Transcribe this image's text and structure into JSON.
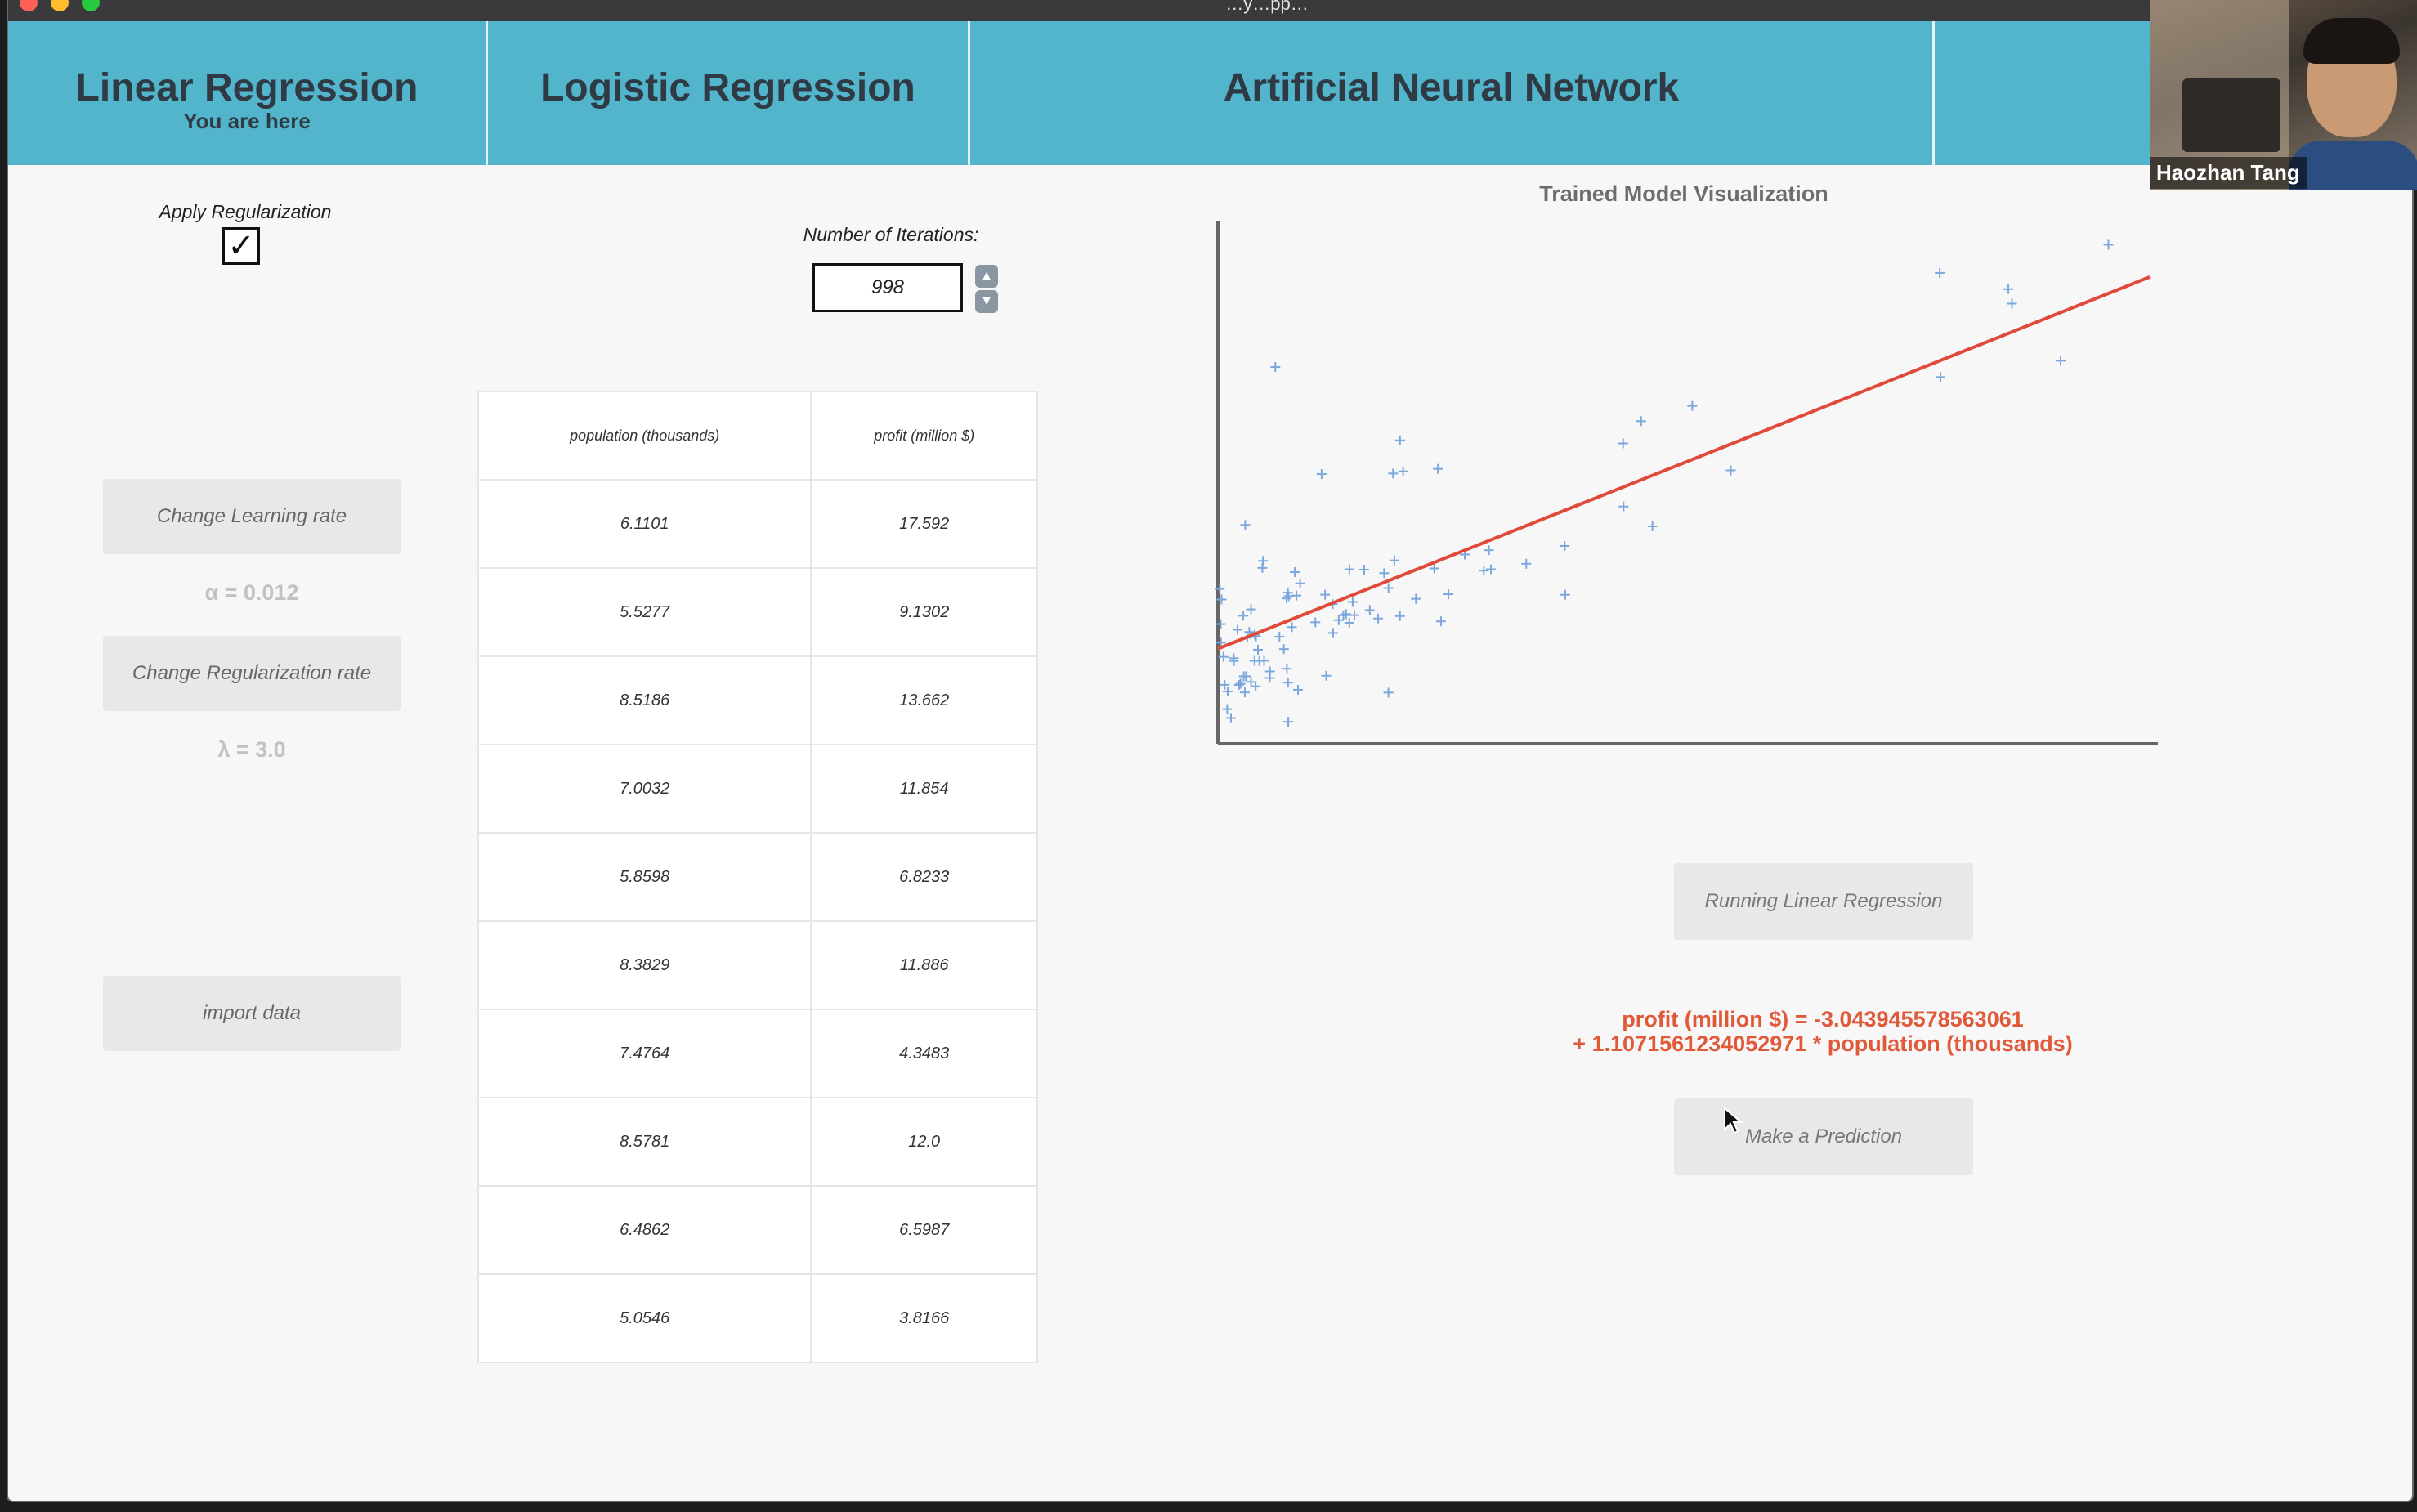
{
  "window": {
    "title": "…y…pp…"
  },
  "nav": {
    "tabs": [
      {
        "label": "Linear Regression",
        "sub": "You are here"
      },
      {
        "label": "Logistic Regression"
      },
      {
        "label": "Artificial Neural Network"
      },
      {
        "label": ""
      }
    ]
  },
  "controls": {
    "regularization_label": "Apply Regularization",
    "regularization_checked": true,
    "iterations_label": "Number of Iterations:",
    "iterations_value": "998",
    "learning_rate_button": "Change Learning rate",
    "alpha_text": "α = 0.012",
    "regularization_rate_button": "Change Regularization rate",
    "lambda_text": "λ = 3.0",
    "import_button": "import data"
  },
  "table": {
    "columns": [
      "population (thousands)",
      "profit (million $)"
    ],
    "rows": [
      [
        "6.1101",
        "17.592"
      ],
      [
        "5.5277",
        "9.1302"
      ],
      [
        "8.5186",
        "13.662"
      ],
      [
        "7.0032",
        "11.854"
      ],
      [
        "5.8598",
        "6.8233"
      ],
      [
        "8.3829",
        "11.886"
      ],
      [
        "7.4764",
        "4.3483"
      ],
      [
        "8.5781",
        "12.0"
      ],
      [
        "6.4862",
        "6.5987"
      ],
      [
        "5.0546",
        "3.8166"
      ]
    ]
  },
  "chart_title": "Trained Model Visualization",
  "chart_data": {
    "type": "scatter",
    "title": "Trained Model Visualization",
    "xlabel": "",
    "ylabel": "",
    "xlim": [
      5,
      23
    ],
    "ylim": [
      -2.6,
      25
    ],
    "grid": false,
    "colors": {
      "points": "#7aa8dc",
      "fit_line": "#e04a3a",
      "axes": "#666666"
    },
    "points": [
      {
        "x": 6.1101,
        "y": 17.592
      },
      {
        "x": 5.5277,
        "y": 9.1302
      },
      {
        "x": 8.5186,
        "y": 13.662
      },
      {
        "x": 7.0032,
        "y": 11.854
      },
      {
        "x": 5.8598,
        "y": 6.8233
      },
      {
        "x": 8.3829,
        "y": 11.886
      },
      {
        "x": 7.4764,
        "y": 4.3483
      },
      {
        "x": 8.5781,
        "y": 12.0
      },
      {
        "x": 6.4862,
        "y": 6.5987
      },
      {
        "x": 5.0546,
        "y": 3.8166
      },
      {
        "x": 5.7107,
        "y": 3.2522
      },
      {
        "x": 14.164,
        "y": 15.505
      },
      {
        "x": 5.734,
        "y": 3.1551
      },
      {
        "x": 8.4084,
        "y": 7.2258
      },
      {
        "x": 5.6407,
        "y": 0.71618
      },
      {
        "x": 5.3794,
        "y": 3.5129
      },
      {
        "x": 6.3654,
        "y": 5.3048
      },
      {
        "x": 5.1301,
        "y": 0.56077
      },
      {
        "x": 6.4296,
        "y": 3.6518
      },
      {
        "x": 7.0708,
        "y": 5.3893
      },
      {
        "x": 6.1891,
        "y": 3.1386
      },
      {
        "x": 20.27,
        "y": 21.767
      },
      {
        "x": 5.4901,
        "y": 4.263
      },
      {
        "x": 6.3261,
        "y": 5.1875
      },
      {
        "x": 5.5649,
        "y": 3.0825
      },
      {
        "x": 18.945,
        "y": 22.638
      },
      {
        "x": 12.828,
        "y": 13.501
      },
      {
        "x": 10.957,
        "y": 7.0467
      },
      {
        "x": 13.176,
        "y": 14.692
      },
      {
        "x": 22.203,
        "y": 24.147
      },
      {
        "x": 5.2524,
        "y": -1.22
      },
      {
        "x": 6.5894,
        "y": 5.9966
      },
      {
        "x": 9.2482,
        "y": 12.134
      },
      {
        "x": 5.8918,
        "y": 1.8495
      },
      {
        "x": 8.2111,
        "y": 6.5426
      },
      {
        "x": 7.9334,
        "y": 4.5623
      },
      {
        "x": 8.0959,
        "y": 4.1164
      },
      {
        "x": 5.6063,
        "y": 3.3928
      },
      {
        "x": 12.836,
        "y": 10.117
      },
      {
        "x": 6.3534,
        "y": 5.4974
      },
      {
        "x": 5.4069,
        "y": 0.55657
      },
      {
        "x": 6.8825,
        "y": 3.9115
      },
      {
        "x": 11.708,
        "y": 5.3854
      },
      {
        "x": 5.7737,
        "y": 2.4406
      },
      {
        "x": 7.8247,
        "y": 6.7318
      },
      {
        "x": 7.0931,
        "y": 1.0463
      },
      {
        "x": 5.0702,
        "y": 5.1337
      },
      {
        "x": 5.8014,
        "y": 1.844
      },
      {
        "x": 11.7,
        "y": 8.0043
      },
      {
        "x": 5.5416,
        "y": 1.0179
      },
      {
        "x": 7.5402,
        "y": 6.7504
      },
      {
        "x": 5.3077,
        "y": 1.8396
      },
      {
        "x": 7.4239,
        "y": 4.2885
      },
      {
        "x": 7.6031,
        "y": 4.9981
      },
      {
        "x": 6.3328,
        "y": 1.4233
      },
      {
        "x": 6.3589,
        "y": -1.4211
      },
      {
        "x": 6.2742,
        "y": 2.4756
      },
      {
        "x": 5.6397,
        "y": 4.6042
      },
      {
        "x": 9.3102,
        "y": 3.9624
      },
      {
        "x": 9.4536,
        "y": 5.4141
      },
      {
        "x": 8.8254,
        "y": 5.1694
      },
      {
        "x": 5.1793,
        "y": -0.74279
      },
      {
        "x": 21.279,
        "y": 17.929
      },
      {
        "x": 14.908,
        "y": 12.054
      },
      {
        "x": 18.959,
        "y": 17.054
      },
      {
        "x": 7.2182,
        "y": 4.8852
      },
      {
        "x": 8.2951,
        "y": 5.7442
      },
      {
        "x": 10.236,
        "y": 7.7754
      },
      {
        "x": 5.4994,
        "y": 1.0173
      },
      {
        "x": 20.341,
        "y": 20.992
      },
      {
        "x": 10.136,
        "y": 6.6799
      },
      {
        "x": 7.3345,
        "y": 4.0259
      },
      {
        "x": 6.0062,
        "y": 1.2784
      },
      {
        "x": 7.2259,
        "y": 3.3411
      },
      {
        "x": 5.0269,
        "y": -2.6807
      },
      {
        "x": 6.5479,
        "y": 0.29678
      },
      {
        "x": 7.5386,
        "y": 3.8845
      },
      {
        "x": 5.0365,
        "y": 5.7014
      },
      {
        "x": 10.274,
        "y": 6.7526
      },
      {
        "x": 5.1077,
        "y": 2.0576
      },
      {
        "x": 5.7292,
        "y": 0.47953
      },
      {
        "x": 5.1884,
        "y": 0.20421
      },
      {
        "x": 6.3557,
        "y": 0.67861
      },
      {
        "x": 9.7687,
        "y": 7.5435
      },
      {
        "x": 6.5159,
        "y": 5.3436
      },
      {
        "x": 8.5172,
        "y": 4.2415
      },
      {
        "x": 9.1802,
        "y": 6.7981
      },
      {
        "x": 6.002,
        "y": 0.92695
      },
      {
        "x": 5.5204,
        "y": 0.152
      },
      {
        "x": 5.0594,
        "y": 2.8214
      },
      {
        "x": 5.7077,
        "y": 1.8451
      },
      {
        "x": 7.6366,
        "y": 4.2959
      },
      {
        "x": 5.8707,
        "y": 7.2029
      },
      {
        "x": 5.3054,
        "y": 1.9869
      },
      {
        "x": 8.2934,
        "y": 0.14454
      },
      {
        "x": 13.394,
        "y": 9.0551
      },
      {
        "x": 5.4369,
        "y": 0.61705
      }
    ],
    "fit_line": {
      "intercept": -3.043945578563061,
      "slope": 1.1071561234052971,
      "x_range": [
        5,
        23
      ]
    }
  },
  "run_button": "Running Linear Regression",
  "equation": {
    "line1": "profit (million $) = -3.043945578563061",
    "line2": "+ 1.1071561234052971 * population (thousands)"
  },
  "predict_button": "Make a Prediction",
  "webcam": {
    "name": "Haozhan Tang"
  }
}
